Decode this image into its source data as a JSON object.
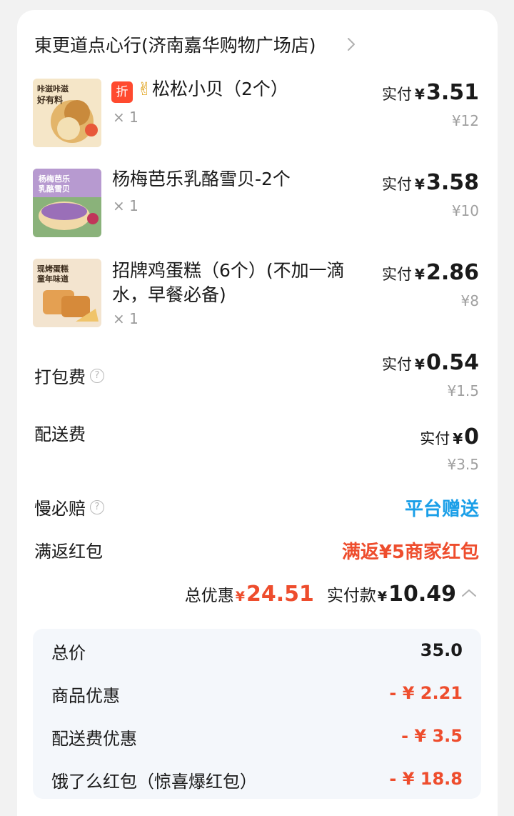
{
  "shop": {
    "name": "東更道点心行(济南嘉华购物广场店)"
  },
  "items": [
    {
      "badge": "折",
      "emoji": "✌",
      "name": "松松小贝（2个）",
      "qty": "× 1",
      "pay_label": "实付",
      "currency": "¥",
      "pay_amount": "3.51",
      "original": "¥12",
      "thumb_text": "咔滋咔滋 好有料"
    },
    {
      "name": "杨梅芭乐乳酪雪贝-2个",
      "qty": "× 1",
      "pay_label": "实付",
      "currency": "¥",
      "pay_amount": "3.58",
      "original": "¥10",
      "thumb_text": "杨梅芭乐 乳酪雪贝"
    },
    {
      "name_line1": "招牌鸡蛋糕（6个）(不加一滴",
      "name_line2": "水，早餐必备)",
      "qty": "× 1",
      "pay_label": "实付",
      "currency": "¥",
      "pay_amount": "2.86",
      "original": "¥8",
      "thumb_text": "现烤蛋糕 童年味道"
    }
  ],
  "fees": {
    "packing": {
      "label": "打包费",
      "pay_label": "实付",
      "currency": "¥",
      "pay_amount": "0.54",
      "original": "¥1.5"
    },
    "delivery": {
      "label": "配送费",
      "pay_label": "实付",
      "currency": "¥",
      "pay_amount": "0",
      "original": "¥3.5"
    },
    "late_comp": {
      "label": "慢必赔",
      "value": "平台赠送"
    },
    "redpack": {
      "label": "满返红包",
      "value": "满返¥5商家红包"
    }
  },
  "totals": {
    "discount_label": "总优惠",
    "currency": "¥",
    "discount_amount": "24.51",
    "paid_label": "实付款",
    "paid_amount": "10.49"
  },
  "summary": [
    {
      "label": "总价",
      "value": "35.0"
    },
    {
      "label": "商品优惠",
      "value": "- ¥ 2.21"
    },
    {
      "label": "配送费优惠",
      "value": "- ¥ 3.5"
    },
    {
      "label": "饿了么红包（惊喜爆红包）",
      "value": "- ¥ 18.8"
    }
  ],
  "colors": {
    "accent_blue": "#1a9fe8",
    "accent_red": "#ee4d2d",
    "badge_red": "#ff4a2f"
  }
}
